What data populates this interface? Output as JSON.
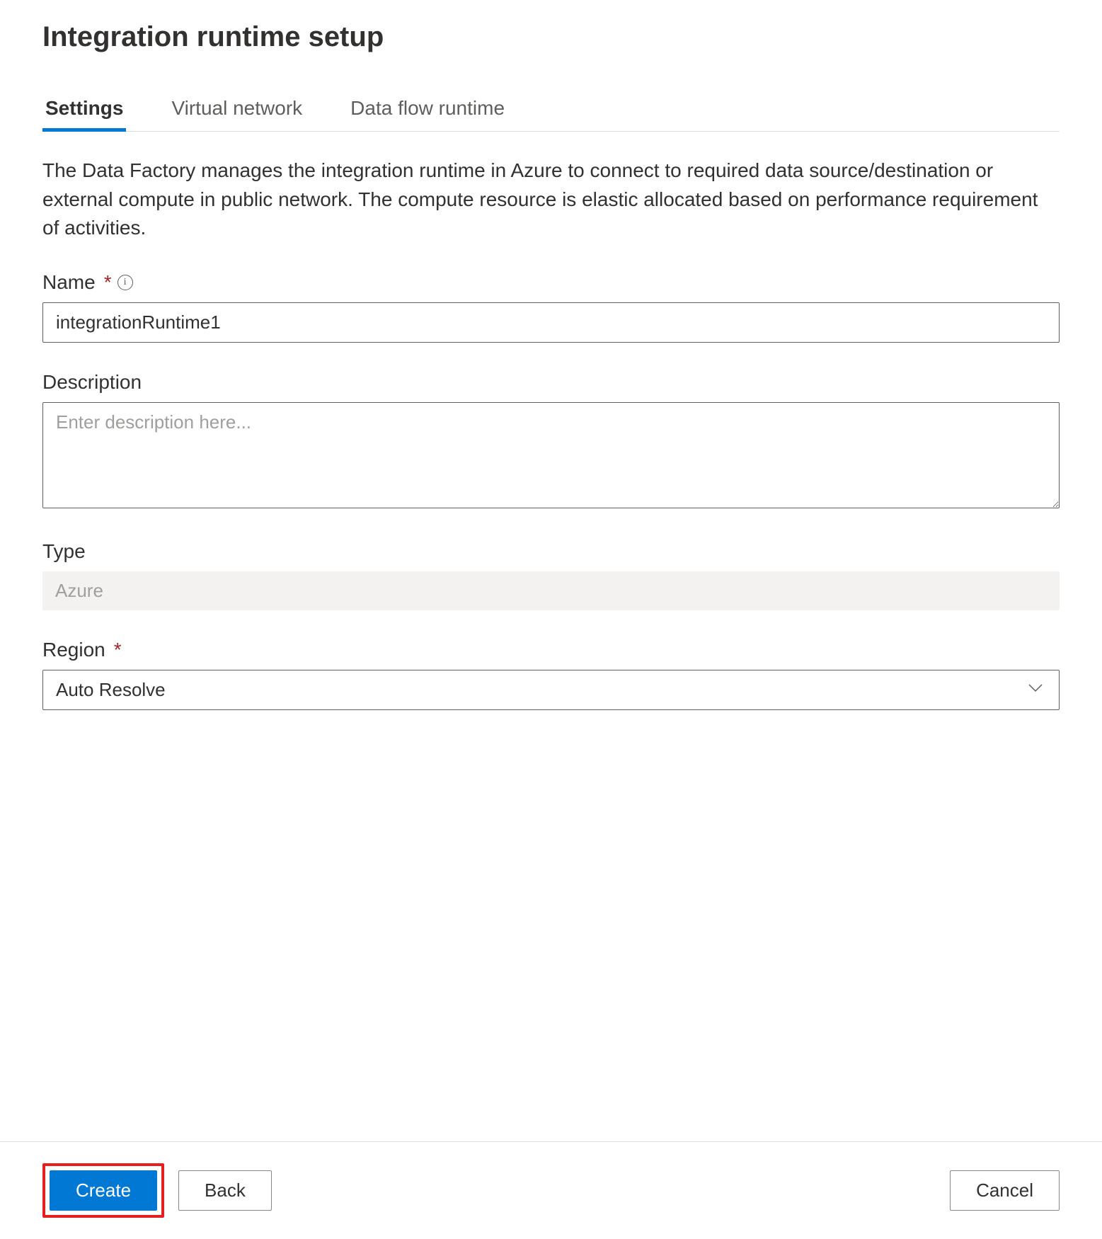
{
  "header": {
    "title": "Integration runtime setup"
  },
  "tabs": {
    "settings": "Settings",
    "virtual_network": "Virtual network",
    "data_flow_runtime": "Data flow runtime"
  },
  "description": "The Data Factory manages the integration runtime in Azure to connect to required data source/destination or external compute in public network. The compute resource is elastic allocated based on performance requirement of activities.",
  "form": {
    "name": {
      "label": "Name",
      "value": "integrationRuntime1"
    },
    "description": {
      "label": "Description",
      "placeholder": "Enter description here..."
    },
    "type": {
      "label": "Type",
      "value": "Azure"
    },
    "region": {
      "label": "Region",
      "value": "Auto Resolve"
    }
  },
  "footer": {
    "create": "Create",
    "back": "Back",
    "cancel": "Cancel"
  }
}
